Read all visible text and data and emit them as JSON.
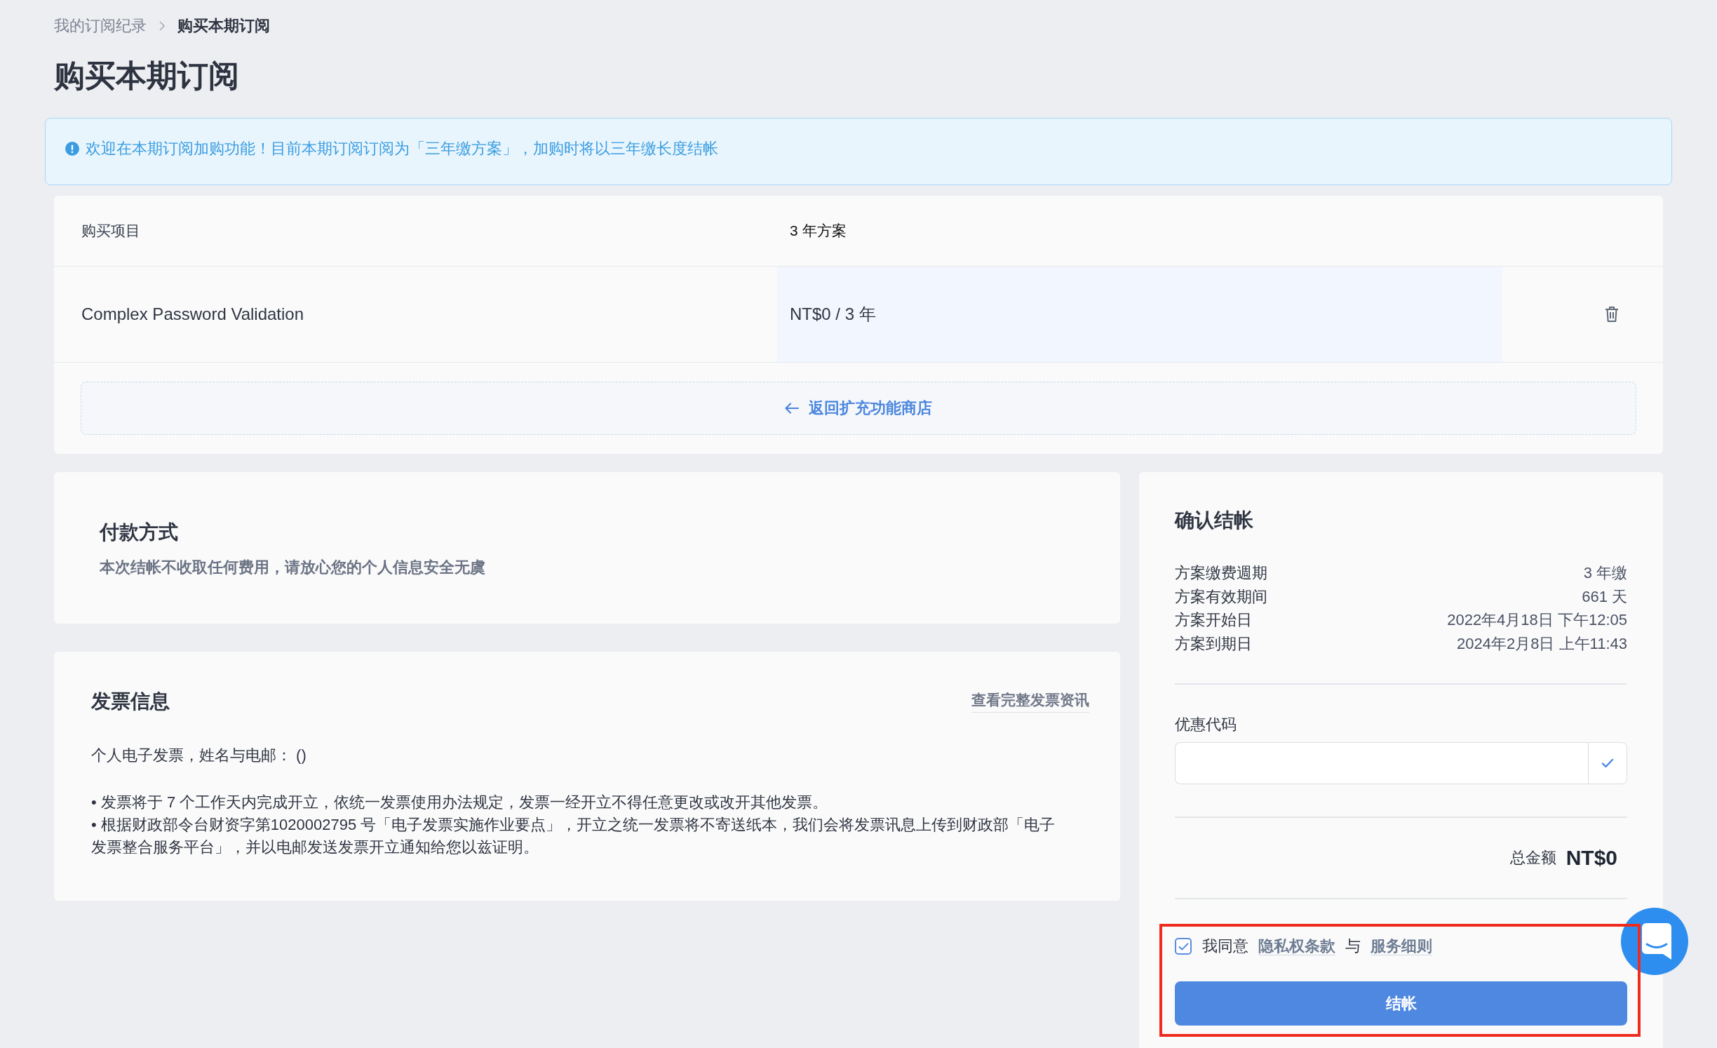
{
  "breadcrumb": [
    {
      "label": "我的订阅纪录",
      "current": false
    },
    {
      "label": "购买本期订阅",
      "current": true
    }
  ],
  "page_title": "购买本期订阅",
  "notice": {
    "text": "欢迎在本期订阅加购功能！目前本期订阅订阅为「三年缴方案」，加购时将以三年缴长度结帐"
  },
  "items_table": {
    "columns": [
      "购买项目",
      "3 年方案"
    ],
    "rows": [
      {
        "item": "Complex Password Validation",
        "price": "NT$0 / 3 年"
      }
    ],
    "back_link": "返回扩充功能商店"
  },
  "payment": {
    "title": "付款方式",
    "note": "本次结帐不收取任何费用，请放心您的个人信息安全无虞"
  },
  "invoice": {
    "title": "发票信息",
    "link": "查看完整发票资讯",
    "type_line": "个人电子发票，姓名与电邮： ()",
    "notes": [
      "• 发票将于 7 个工作天内完成开立，依统一发票使用办法规定，发票一经开立不得任意更改或改开其他发票。",
      "• 根据财政部令台财资字第1020002795 号「电子发票实施作业要点」，开立之统一发票将不寄送纸本，我们会将发票讯息上传到财政部「电子发票整合服务平台」，并以电邮发送发票开立通知给您以兹证明。"
    ]
  },
  "checkout": {
    "title": "确认结帐",
    "details": [
      {
        "label": "方案缴费週期",
        "value": "3 年缴"
      },
      {
        "label": "方案有效期间",
        "value": "661 天"
      },
      {
        "label": "方案开始日",
        "value": "2022年4月18日 下午12:05"
      },
      {
        "label": "方案到期日",
        "value": "2024年2月8日 上午11:43"
      }
    ],
    "coupon_label": "优惠代码",
    "total": {
      "label": "总金额",
      "value": "NT$0"
    },
    "agreement": {
      "checked": true,
      "parts": [
        {
          "kind": "text",
          "text": "我同意"
        },
        {
          "kind": "link",
          "text": "隐私权条款"
        },
        {
          "kind": "text",
          "text": "与"
        },
        {
          "kind": "link",
          "text": "服务细则"
        }
      ]
    },
    "submit": "结帐",
    "highlight": true
  }
}
